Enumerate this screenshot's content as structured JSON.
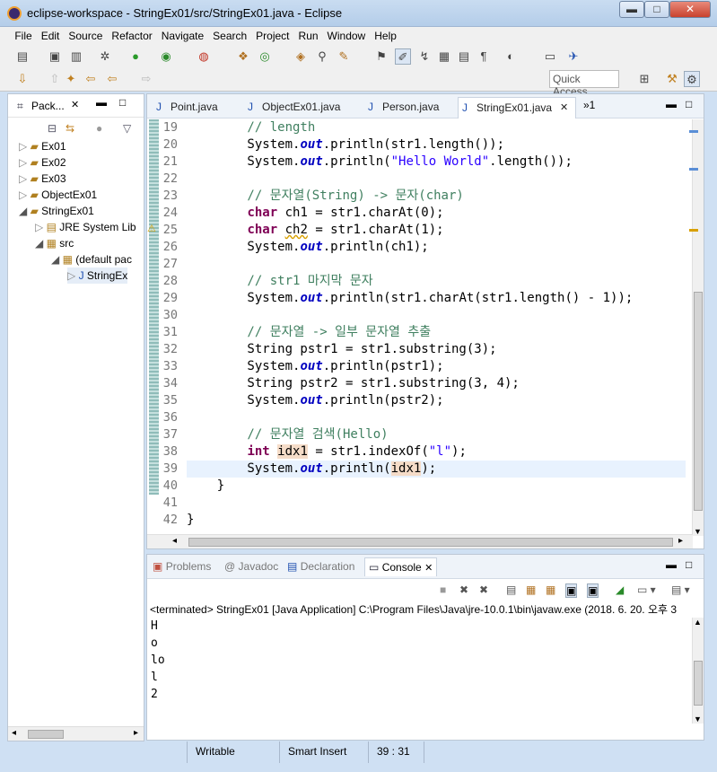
{
  "window": {
    "title": "eclipse-workspace - StringEx01/src/StringEx01.java - Eclipse",
    "min": "▬",
    "max": "□",
    "close": "✕"
  },
  "menu": [
    "File",
    "Edit",
    "Source",
    "Refactor",
    "Navigate",
    "Search",
    "Project",
    "Run",
    "Window",
    "Help"
  ],
  "quick_access": "Quick Access",
  "explorer": {
    "tab_label": "Pack...",
    "items": [
      {
        "label": "Ex01"
      },
      {
        "label": "Ex02"
      },
      {
        "label": "Ex03"
      },
      {
        "label": "ObjectEx01"
      },
      {
        "label": "StringEx01"
      },
      {
        "label": "JRE System Lib"
      },
      {
        "label": "src"
      },
      {
        "label": "(default pac"
      },
      {
        "label": "StringEx"
      }
    ]
  },
  "editor": {
    "tabs": [
      {
        "label": "Point.java"
      },
      {
        "label": "ObjectEx01.java"
      },
      {
        "label": "Person.java"
      },
      {
        "label": "StringEx01.java"
      }
    ],
    "overflow": "»1"
  },
  "code": [
    {
      "n": "19",
      "t": "        // length"
    },
    {
      "n": "20",
      "t": "        System.out.println(str1.length());"
    },
    {
      "n": "21",
      "t": "        System.out.println(\"Hello World\".length());"
    },
    {
      "n": "22",
      "t": ""
    },
    {
      "n": "23",
      "t": "        // 문자열(String) -> 문자(char)"
    },
    {
      "n": "24",
      "t": "        char ch1 = str1.charAt(0);"
    },
    {
      "n": "25",
      "t": "        char ch2 = str1.charAt(1);"
    },
    {
      "n": "26",
      "t": "        System.out.println(ch1);"
    },
    {
      "n": "27",
      "t": ""
    },
    {
      "n": "28",
      "t": "        // str1 마지막 문자"
    },
    {
      "n": "29",
      "t": "        System.out.println(str1.charAt(str1.length() - 1));"
    },
    {
      "n": "30",
      "t": ""
    },
    {
      "n": "31",
      "t": "        // 문자열 -> 일부 문자열 추출"
    },
    {
      "n": "32",
      "t": "        String pstr1 = str1.substring(3);"
    },
    {
      "n": "33",
      "t": "        System.out.println(pstr1);"
    },
    {
      "n": "34",
      "t": "        String pstr2 = str1.substring(3, 4);"
    },
    {
      "n": "35",
      "t": "        System.out.println(pstr2);"
    },
    {
      "n": "36",
      "t": ""
    },
    {
      "n": "37",
      "t": "        // 문자열 검색(Hello)"
    },
    {
      "n": "38",
      "t": "        int idx1 = str1.indexOf(\"l\");"
    },
    {
      "n": "39",
      "t": "        System.out.println(idx1);"
    },
    {
      "n": "40",
      "t": "    }"
    },
    {
      "n": "41",
      "t": ""
    },
    {
      "n": "42",
      "t": "}"
    }
  ],
  "console": {
    "tabs": [
      {
        "label": "Problems"
      },
      {
        "label": "Javadoc"
      },
      {
        "label": "Declaration"
      },
      {
        "label": "Console"
      }
    ],
    "terminated": "<terminated> StringEx01 [Java Application] C:\\Program Files\\Java\\jre-10.0.1\\bin\\javaw.exe (2018. 6. 20. 오후 3",
    "output": [
      "H",
      "o",
      "lo",
      "l",
      "2"
    ]
  },
  "status": {
    "writable": "Writable",
    "insert": "Smart Insert",
    "position": "39 : 31"
  }
}
